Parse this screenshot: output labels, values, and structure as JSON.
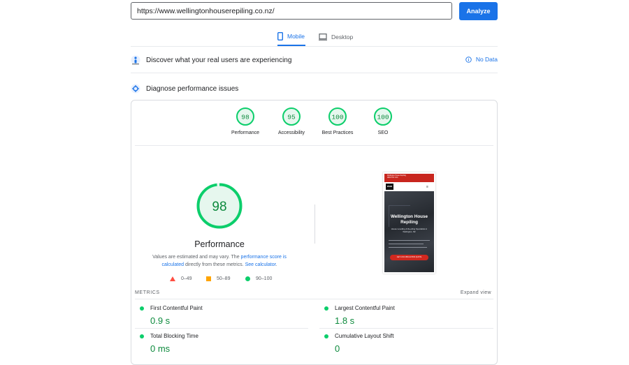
{
  "search": {
    "url_value": "https://www.wellingtonhouserepiling.co.nz/",
    "analyze_label": "Analyze"
  },
  "tabs": [
    {
      "label": "Mobile"
    },
    {
      "label": "Desktop"
    }
  ],
  "sections": {
    "real_users": {
      "title": "Discover what your real users are experiencing",
      "status": "No Data"
    },
    "diagnose": {
      "title": "Diagnose performance issues"
    }
  },
  "scores": [
    {
      "value": "98",
      "label": "Performance"
    },
    {
      "value": "95",
      "label": "Accessibility"
    },
    {
      "value": "100",
      "label": "Best Practices"
    },
    {
      "value": "100",
      "label": "SEO"
    }
  ],
  "performance": {
    "score": "98",
    "title": "Performance",
    "note_prefix": "Values are estimated and may vary. The",
    "note_link1": "performance score is calculated",
    "note_middle": "directly from these metrics.",
    "note_link2": "See calculator",
    "note_end": "."
  },
  "legend": {
    "red": "0–49",
    "orange": "50–89",
    "green": "90–100"
  },
  "colors": {
    "accent": "#1a73e8",
    "pass": "#0cce6b",
    "pass_text": "#0d8a3d",
    "average": "#ffa400",
    "fail": "#ff4e42"
  },
  "preview": {
    "top_line1": "Wellington House Repiling",
    "top_line2": "0800 XXX XXX",
    "logo": "WHR",
    "heading": "Wellington House Repiling",
    "sub1": "House Levelling & Re-piling Specialists in",
    "sub2": "Wellington, NZ",
    "cta": "GET A NO-OBLIGATION QUOTE"
  },
  "metrics": {
    "label": "METRICS",
    "expand": "Expand view",
    "items": [
      {
        "name": "First Contentful Paint",
        "value": "0.9 s"
      },
      {
        "name": "Largest Contentful Paint",
        "value": "1.8 s"
      },
      {
        "name": "Total Blocking Time",
        "value": "0 ms"
      },
      {
        "name": "Cumulative Layout Shift",
        "value": "0"
      }
    ]
  }
}
